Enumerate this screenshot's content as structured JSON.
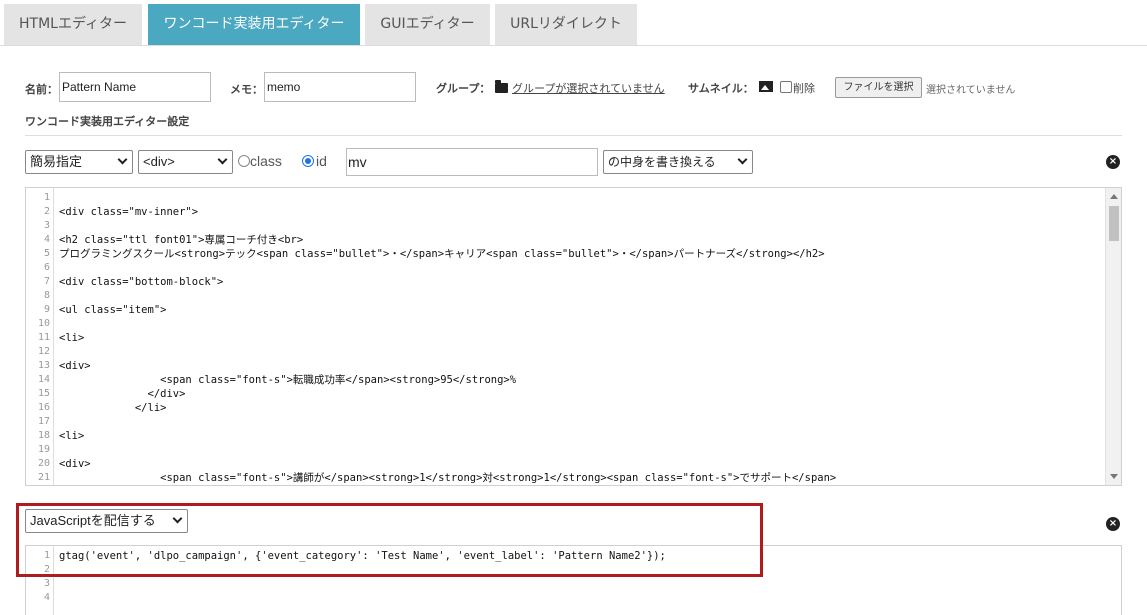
{
  "tabs": [
    {
      "label": "HTMLエディター",
      "active": false
    },
    {
      "label": "ワンコード実装用エディター",
      "active": true
    },
    {
      "label": "GUIエディター",
      "active": false
    },
    {
      "label": "URLリダイレクト",
      "active": false
    }
  ],
  "form": {
    "name_label": "名前：",
    "name_value": "Pattern Name",
    "memo_label": "メモ：",
    "memo_value": "memo",
    "group_label": "グループ：",
    "group_link": "グループが選択されていません",
    "thumbnail_label": "サムネイル：",
    "delete_label": "削除",
    "file_button": "ファイルを選択",
    "file_status": "選択されていません"
  },
  "section_title": "ワンコード実装用エディター設定",
  "rule": {
    "mode_select": "簡易指定",
    "tag_select": "<div>",
    "radio_class": "class",
    "radio_id": "id",
    "selector_value": "mv",
    "action_select": "の中身を書き換える",
    "selected_radio": "id"
  },
  "html_editor": {
    "lines": [
      "",
      "<div class=\"mv-inner\">",
      "",
      "<h2 class=\"ttl font01\">専属コーチ付き<br>",
      "プログラミングスクール<strong>テック<span class=\"bullet\">・</span>キャリア<span class=\"bullet\">・</span>パートナーズ</strong></h2>",
      "",
      "<div class=\"bottom-block\">",
      "",
      "<ul class=\"item\">",
      "",
      "<li>",
      "",
      "<div>",
      "                <span class=\"font-s\">転職成功率</span><strong>95</strong>%",
      "              </div>",
      "            </li>",
      "",
      "<li>",
      "",
      "<div>",
      "                <span class=\"font-s\">講師が</span><strong>1</strong>対<strong>1</strong><span class=\"font-s\">でサポート</span>"
    ]
  },
  "js": {
    "select": "JavaScriptを配信する",
    "lines": [
      "gtag('event', 'dlpo_campaign', {'event_category': 'Test Name', 'event_label': 'Pattern Name2'});",
      "",
      "",
      ""
    ]
  },
  "icons": {
    "close": "×"
  },
  "colors": {
    "active_tab": "#4aa8c0",
    "highlight_box": "#b01c1c"
  }
}
